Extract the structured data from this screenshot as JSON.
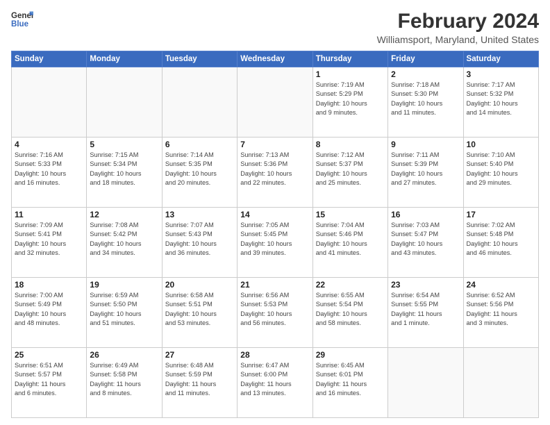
{
  "logo": {
    "line1": "General",
    "line2": "Blue"
  },
  "title": "February 2024",
  "subtitle": "Williamsport, Maryland, United States",
  "headers": [
    "Sunday",
    "Monday",
    "Tuesday",
    "Wednesday",
    "Thursday",
    "Friday",
    "Saturday"
  ],
  "days": [
    [
      {
        "num": "",
        "info": ""
      },
      {
        "num": "",
        "info": ""
      },
      {
        "num": "",
        "info": ""
      },
      {
        "num": "",
        "info": ""
      },
      {
        "num": "1",
        "info": "Sunrise: 7:19 AM\nSunset: 5:29 PM\nDaylight: 10 hours\nand 9 minutes."
      },
      {
        "num": "2",
        "info": "Sunrise: 7:18 AM\nSunset: 5:30 PM\nDaylight: 10 hours\nand 11 minutes."
      },
      {
        "num": "3",
        "info": "Sunrise: 7:17 AM\nSunset: 5:32 PM\nDaylight: 10 hours\nand 14 minutes."
      }
    ],
    [
      {
        "num": "4",
        "info": "Sunrise: 7:16 AM\nSunset: 5:33 PM\nDaylight: 10 hours\nand 16 minutes."
      },
      {
        "num": "5",
        "info": "Sunrise: 7:15 AM\nSunset: 5:34 PM\nDaylight: 10 hours\nand 18 minutes."
      },
      {
        "num": "6",
        "info": "Sunrise: 7:14 AM\nSunset: 5:35 PM\nDaylight: 10 hours\nand 20 minutes."
      },
      {
        "num": "7",
        "info": "Sunrise: 7:13 AM\nSunset: 5:36 PM\nDaylight: 10 hours\nand 22 minutes."
      },
      {
        "num": "8",
        "info": "Sunrise: 7:12 AM\nSunset: 5:37 PM\nDaylight: 10 hours\nand 25 minutes."
      },
      {
        "num": "9",
        "info": "Sunrise: 7:11 AM\nSunset: 5:39 PM\nDaylight: 10 hours\nand 27 minutes."
      },
      {
        "num": "10",
        "info": "Sunrise: 7:10 AM\nSunset: 5:40 PM\nDaylight: 10 hours\nand 29 minutes."
      }
    ],
    [
      {
        "num": "11",
        "info": "Sunrise: 7:09 AM\nSunset: 5:41 PM\nDaylight: 10 hours\nand 32 minutes."
      },
      {
        "num": "12",
        "info": "Sunrise: 7:08 AM\nSunset: 5:42 PM\nDaylight: 10 hours\nand 34 minutes."
      },
      {
        "num": "13",
        "info": "Sunrise: 7:07 AM\nSunset: 5:43 PM\nDaylight: 10 hours\nand 36 minutes."
      },
      {
        "num": "14",
        "info": "Sunrise: 7:05 AM\nSunset: 5:45 PM\nDaylight: 10 hours\nand 39 minutes."
      },
      {
        "num": "15",
        "info": "Sunrise: 7:04 AM\nSunset: 5:46 PM\nDaylight: 10 hours\nand 41 minutes."
      },
      {
        "num": "16",
        "info": "Sunrise: 7:03 AM\nSunset: 5:47 PM\nDaylight: 10 hours\nand 43 minutes."
      },
      {
        "num": "17",
        "info": "Sunrise: 7:02 AM\nSunset: 5:48 PM\nDaylight: 10 hours\nand 46 minutes."
      }
    ],
    [
      {
        "num": "18",
        "info": "Sunrise: 7:00 AM\nSunset: 5:49 PM\nDaylight: 10 hours\nand 48 minutes."
      },
      {
        "num": "19",
        "info": "Sunrise: 6:59 AM\nSunset: 5:50 PM\nDaylight: 10 hours\nand 51 minutes."
      },
      {
        "num": "20",
        "info": "Sunrise: 6:58 AM\nSunset: 5:51 PM\nDaylight: 10 hours\nand 53 minutes."
      },
      {
        "num": "21",
        "info": "Sunrise: 6:56 AM\nSunset: 5:53 PM\nDaylight: 10 hours\nand 56 minutes."
      },
      {
        "num": "22",
        "info": "Sunrise: 6:55 AM\nSunset: 5:54 PM\nDaylight: 10 hours\nand 58 minutes."
      },
      {
        "num": "23",
        "info": "Sunrise: 6:54 AM\nSunset: 5:55 PM\nDaylight: 11 hours\nand 1 minute."
      },
      {
        "num": "24",
        "info": "Sunrise: 6:52 AM\nSunset: 5:56 PM\nDaylight: 11 hours\nand 3 minutes."
      }
    ],
    [
      {
        "num": "25",
        "info": "Sunrise: 6:51 AM\nSunset: 5:57 PM\nDaylight: 11 hours\nand 6 minutes."
      },
      {
        "num": "26",
        "info": "Sunrise: 6:49 AM\nSunset: 5:58 PM\nDaylight: 11 hours\nand 8 minutes."
      },
      {
        "num": "27",
        "info": "Sunrise: 6:48 AM\nSunset: 5:59 PM\nDaylight: 11 hours\nand 11 minutes."
      },
      {
        "num": "28",
        "info": "Sunrise: 6:47 AM\nSunset: 6:00 PM\nDaylight: 11 hours\nand 13 minutes."
      },
      {
        "num": "29",
        "info": "Sunrise: 6:45 AM\nSunset: 6:01 PM\nDaylight: 11 hours\nand 16 minutes."
      },
      {
        "num": "",
        "info": ""
      },
      {
        "num": "",
        "info": ""
      }
    ]
  ]
}
